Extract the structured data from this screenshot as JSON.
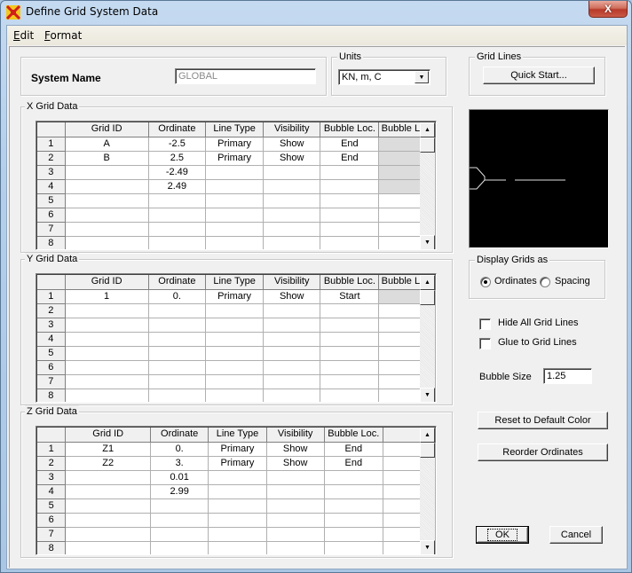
{
  "window": {
    "title": "Define Grid System Data",
    "close_label": "X"
  },
  "menu": {
    "items": [
      {
        "label": "Edit",
        "mnemonic": "E"
      },
      {
        "label": "Format",
        "mnemonic": "F"
      }
    ]
  },
  "system": {
    "name_label": "System Name",
    "name_value": "GLOBAL"
  },
  "units": {
    "group_label": "Units",
    "selected": "KN, m, C"
  },
  "grid_lines": {
    "group_label": "Grid Lines",
    "quick_start_label": "Quick Start..."
  },
  "columns_xy": [
    "",
    "Grid ID",
    "Ordinate",
    "Line Type",
    "Visibility",
    "Bubble Loc.",
    "Bubble Loc."
  ],
  "columns_z": [
    "",
    "Grid ID",
    "Ordinate",
    "Line Type",
    "Visibility",
    "Bubble Loc.",
    ""
  ],
  "x_grid": {
    "group_label": "X Grid Data",
    "rows": [
      [
        "1",
        "A",
        "-2.5",
        "Primary",
        "Show",
        "End",
        ""
      ],
      [
        "2",
        "B",
        "2.5",
        "Primary",
        "Show",
        "End",
        ""
      ],
      [
        "3",
        "",
        "-2.49",
        "",
        "",
        "",
        ""
      ],
      [
        "4",
        "",
        "2.49",
        "",
        "",
        "",
        ""
      ],
      [
        "5",
        "",
        "",
        "",
        "",
        "",
        ""
      ],
      [
        "6",
        "",
        "",
        "",
        "",
        "",
        ""
      ],
      [
        "7",
        "",
        "",
        "",
        "",
        "",
        ""
      ],
      [
        "8",
        "",
        "",
        "",
        "",
        "",
        ""
      ]
    ],
    "shaded_last_col_rows": 4
  },
  "y_grid": {
    "group_label": "Y Grid Data",
    "rows": [
      [
        "1",
        "1",
        "0.",
        "Primary",
        "Show",
        "Start",
        ""
      ],
      [
        "2",
        "",
        "",
        "",
        "",
        "",
        ""
      ],
      [
        "3",
        "",
        "",
        "",
        "",
        "",
        ""
      ],
      [
        "4",
        "",
        "",
        "",
        "",
        "",
        ""
      ],
      [
        "5",
        "",
        "",
        "",
        "",
        "",
        ""
      ],
      [
        "6",
        "",
        "",
        "",
        "",
        "",
        ""
      ],
      [
        "7",
        "",
        "",
        "",
        "",
        "",
        ""
      ],
      [
        "8",
        "",
        "",
        "",
        "",
        "",
        ""
      ]
    ],
    "shaded_last_col_rows": 1
  },
  "z_grid": {
    "group_label": "Z Grid Data",
    "rows": [
      [
        "1",
        "Z1",
        "0.",
        "Primary",
        "Show",
        "End",
        ""
      ],
      [
        "2",
        "Z2",
        "3.",
        "Primary",
        "Show",
        "End",
        ""
      ],
      [
        "3",
        "",
        "0.01",
        "",
        "",
        "",
        ""
      ],
      [
        "4",
        "",
        "2.99",
        "",
        "",
        "",
        ""
      ],
      [
        "5",
        "",
        "",
        "",
        "",
        "",
        ""
      ],
      [
        "6",
        "",
        "",
        "",
        "",
        "",
        ""
      ],
      [
        "7",
        "",
        "",
        "",
        "",
        "",
        ""
      ],
      [
        "8",
        "",
        "",
        "",
        "",
        "",
        ""
      ]
    ],
    "shaded_last_col_rows": 0
  },
  "display_grids": {
    "group_label": "Display Grids as",
    "options": [
      {
        "label": "Ordinates",
        "checked": true
      },
      {
        "label": "Spacing",
        "checked": false
      }
    ]
  },
  "options": {
    "hide_all_label": "Hide All Grid Lines",
    "hide_all_checked": false,
    "glue_label": "Glue to Grid Lines",
    "glue_checked": false,
    "bubble_size_label": "Bubble Size",
    "bubble_size_value": "1.25"
  },
  "buttons": {
    "reset_color": "Reset to Default Color",
    "reorder": "Reorder Ordinates",
    "ok": "OK",
    "cancel": "Cancel"
  },
  "icons": {
    "combo_arrow": "▼",
    "scroll_up": "▲",
    "scroll_down": "▼"
  }
}
